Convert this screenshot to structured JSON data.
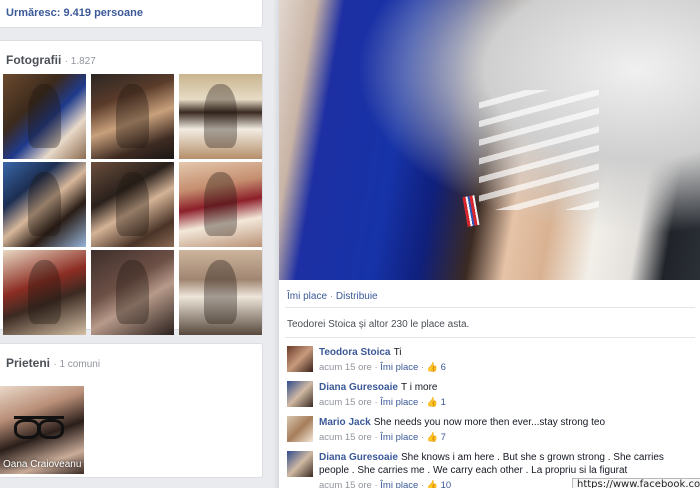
{
  "follow": {
    "label": "Urmăresc:",
    "count": "9.419 persoane"
  },
  "photos": {
    "title": "Fotografii",
    "count": "1.827",
    "thumbs": [
      "photo-1",
      "photo-2",
      "photo-3",
      "photo-4",
      "photo-5",
      "photo-6",
      "photo-7",
      "photo-8",
      "photo-9"
    ]
  },
  "friends": {
    "title": "Prieteni",
    "mutual": "1 comuni",
    "items": [
      {
        "name": "Oana Craioveanu"
      }
    ]
  },
  "viewer": {
    "actions": {
      "like": "Îmi place",
      "share": "Distribuie",
      "separator": "·"
    },
    "likes_text": "Teodorei Stoica și altor 230 le place asta.",
    "comments": [
      {
        "name": "Teodora Stoica",
        "text": "Ti",
        "time": "acum 15 ore",
        "like": "Îmi place",
        "likes": "6"
      },
      {
        "name": "Diana Guresoaie",
        "text": "T i more",
        "time": "acum 15 ore",
        "like": "Îmi place",
        "likes": "1"
      },
      {
        "name": "Mario Jack",
        "text": "She needs you now more then ever...stay strong teo",
        "time": "acum 15 ore",
        "like": "Îmi place",
        "likes": "7"
      },
      {
        "name": "Diana Guresoaie",
        "text": "She knows i am here . But she s grown strong . She carries people . She carries me . We carry each other . La propriu si la figurat",
        "time": "acum 15 ore",
        "like": "Îmi place",
        "likes": "10"
      }
    ]
  },
  "status_url": "https://www.facebook.com",
  "colors": {
    "link": "#3b5998",
    "background": "#e9ebee",
    "muted": "#90949c"
  }
}
